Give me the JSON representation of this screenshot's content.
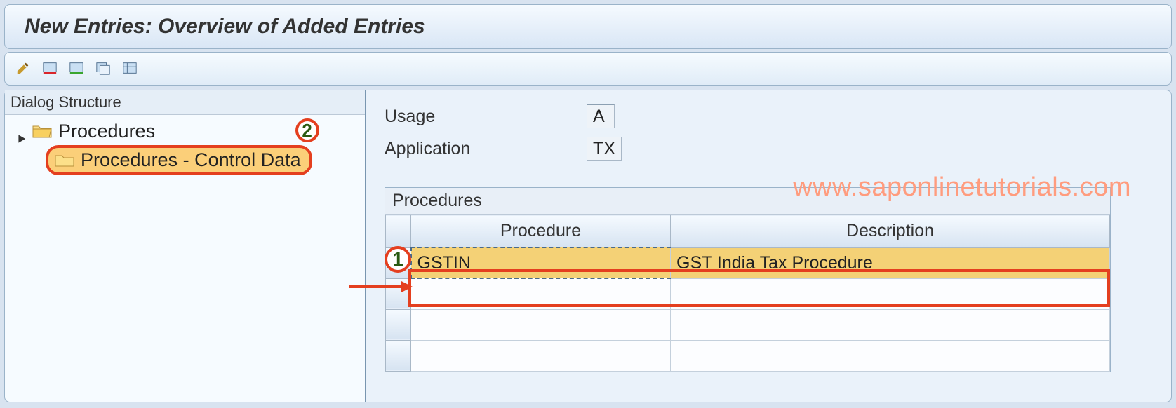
{
  "title": "New Entries: Overview of Added Entries",
  "toolbar_icons": [
    "pencil-icon",
    "table-minus-icon",
    "table-plus-icon",
    "table-copy-icon",
    "table-config-icon"
  ],
  "tree": {
    "header": "Dialog Structure",
    "root": {
      "label": "Procedures"
    },
    "child": {
      "label": "Procedures - Control Data"
    }
  },
  "form": {
    "usage_label": "Usage",
    "usage_value": "A",
    "application_label": "Application",
    "application_value": "TX"
  },
  "grid": {
    "title": "Procedures",
    "columns": {
      "procedure": "Procedure",
      "description": "Description"
    },
    "rows": [
      {
        "procedure": "GSTIN",
        "description": "GST India Tax Procedure",
        "selected": true
      },
      {
        "procedure": "",
        "description": ""
      },
      {
        "procedure": "",
        "description": ""
      },
      {
        "procedure": "",
        "description": ""
      }
    ]
  },
  "annotations": {
    "step1": "1",
    "step2": "2"
  },
  "watermark": "www.saponlinetutorials.com"
}
